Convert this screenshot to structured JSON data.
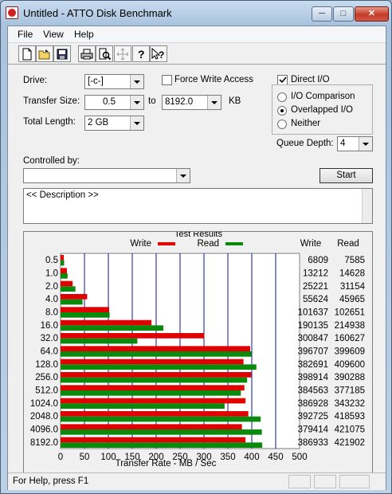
{
  "window": {
    "title": "Untitled - ATTO Disk Benchmark",
    "min_glyph": "─",
    "max_glyph": "□",
    "close_glyph": "✕"
  },
  "menu": {
    "items": [
      "File",
      "View",
      "Help"
    ]
  },
  "toolbar": {
    "icons": [
      "new-icon",
      "open-icon",
      "save-icon",
      "print-icon",
      "print-preview-icon",
      "move-icon",
      "help-icon",
      "context-help-icon"
    ]
  },
  "form": {
    "drive_label": "Drive:",
    "drive_value": "[-c-]",
    "force_write_label": "Force Write Access",
    "force_write_checked": false,
    "direct_io_label": "Direct I/O",
    "direct_io_checked": true,
    "transfer_size_label": "Transfer Size:",
    "transfer_from": "0.5",
    "to_label": "to",
    "transfer_to": "8192.0",
    "kb_label": "KB",
    "total_length_label": "Total Length:",
    "total_length_value": "2 GB",
    "io_options": [
      "I/O Comparison",
      "Overlapped I/O",
      "Neither"
    ],
    "io_selected": "Overlapped I/O",
    "queue_depth_label": "Queue Depth:",
    "queue_depth_value": "4",
    "controlled_by_label": "Controlled by:",
    "controlled_by_value": "",
    "start_label": "Start",
    "description": "<< Description >>"
  },
  "results": {
    "group_title": "Test Results",
    "write_legend": "Write",
    "read_legend": "Read",
    "write_col_header": "Write",
    "read_col_header": "Read",
    "write_color": "#e00000",
    "read_color": "#0a8a0a",
    "grid_color": "#1010a0"
  },
  "chart_data": {
    "type": "bar",
    "orientation": "horizontal",
    "categories": [
      "0.5",
      "1.0",
      "2.0",
      "4.0",
      "8.0",
      "16.0",
      "32.0",
      "64.0",
      "128.0",
      "256.0",
      "512.0",
      "1024.0",
      "2048.0",
      "4096.0",
      "8192.0"
    ],
    "series": [
      {
        "name": "Write",
        "values": [
          6809,
          13212,
          25221,
          55624,
          101637,
          190135,
          300847,
          396707,
          382691,
          398914,
          384563,
          386928,
          392725,
          379414,
          386933
        ]
      },
      {
        "name": "Read",
        "values": [
          7585,
          14628,
          31154,
          45965,
          102651,
          214938,
          160627,
          399609,
          409600,
          390288,
          377185,
          343232,
          418593,
          421075,
          421902
        ]
      }
    ],
    "xlabel": "Transfer Rate - MB / Sec",
    "xticks": [
      "0",
      "50",
      "100",
      "150",
      "200",
      "250",
      "300",
      "350",
      "400",
      "450",
      "500"
    ],
    "xlim": [
      0,
      500
    ],
    "value_units_note_scale": 1000
  },
  "status": {
    "text": "For Help, press F1"
  }
}
